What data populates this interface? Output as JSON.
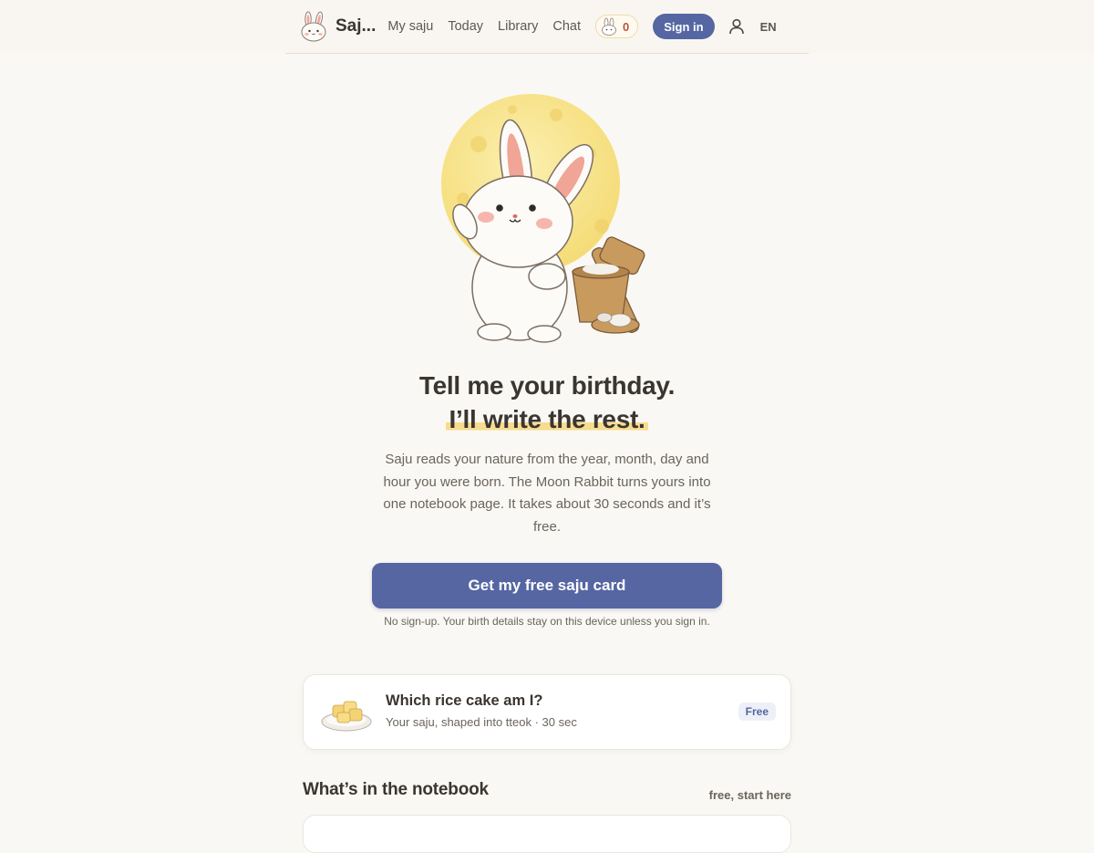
{
  "header": {
    "brand_name": "Saj...",
    "brand_icon": "rabbit-logo-icon",
    "nav": [
      {
        "label": "My saju"
      },
      {
        "label": "Today"
      },
      {
        "label": "Library"
      },
      {
        "label": "Chat"
      }
    ],
    "points": "0",
    "signin_label": "Sign in",
    "user_icon": "user-icon",
    "language": "EN"
  },
  "hero": {
    "headline_line1": "Tell me your birthday.",
    "headline_line2": "I’ll write the rest.",
    "lead": "Saju reads your nature from the year, month, day and hour you were born. The Moon Rabbit turns yours into one notebook page. It takes about 30 seconds and it’s free.",
    "cta_label": "Get my free saju card",
    "cta_note": "No sign-up. Your birth details stay on this device unless you sign in."
  },
  "feature_card": {
    "title": "Which rice cake am I?",
    "subtitle": "Your saju, shaped into tteok · 30 sec",
    "badge": "Free",
    "icon": "rice-cake-icon"
  },
  "notebook_section": {
    "title": "What’s in the notebook",
    "aside": "free, start here"
  },
  "colors": {
    "accent": "#5566a2",
    "background": "#faf8f4",
    "highlight": "#f7dc8e",
    "points": "#b5563a"
  }
}
